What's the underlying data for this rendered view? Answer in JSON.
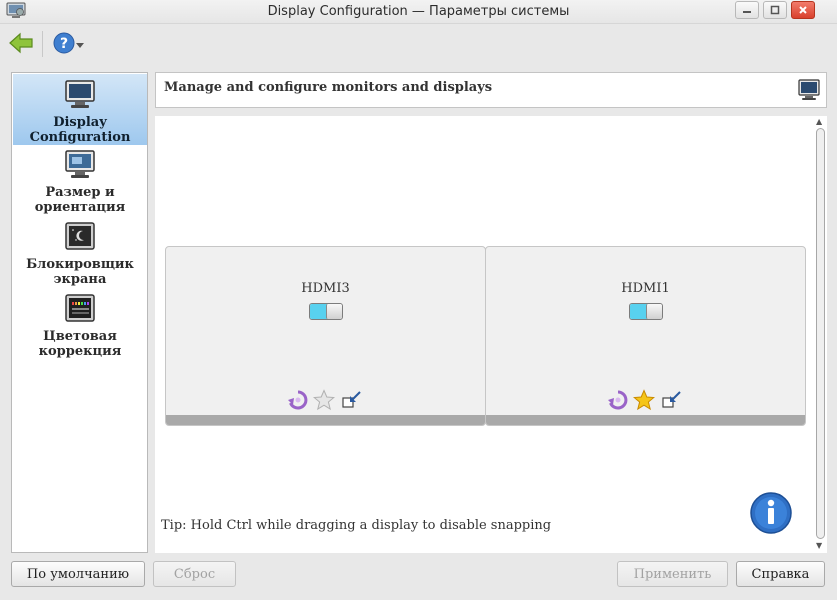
{
  "window": {
    "title": "Display Configuration — Параметры системы"
  },
  "toolbar": {
    "back_icon": "back-arrow-icon",
    "help_icon": "help-icon"
  },
  "sidebar": {
    "items": [
      {
        "label_line1": "Display",
        "label_line2": "Configuration",
        "icon": "monitor-icon",
        "active": true
      },
      {
        "label_line1": "Размер и",
        "label_line2": "ориентация",
        "icon": "monitor-resize-icon",
        "active": false
      },
      {
        "label_line1": "Блокировщик",
        "label_line2": "экрана",
        "icon": "screen-lock-icon",
        "active": false
      },
      {
        "label_line1": "Цветовая",
        "label_line2": "коррекция",
        "icon": "color-correction-icon",
        "active": false
      }
    ]
  },
  "header": {
    "title": "Manage and configure monitors and displays",
    "icon": "monitor-icon"
  },
  "displays": [
    {
      "name": "HDMI3",
      "enabled": true,
      "primary": false
    },
    {
      "name": "HDMI1",
      "enabled": true,
      "primary": true
    }
  ],
  "tip": "Tip: Hold Ctrl while dragging a display to disable snapping",
  "buttons": {
    "defaults": "По умолчанию",
    "reset": "Сброс",
    "apply": "Применить",
    "help": "Справка"
  },
  "colors": {
    "accent": "#58d1ef",
    "selection": "#9ec8ee",
    "close": "#d9412d"
  }
}
